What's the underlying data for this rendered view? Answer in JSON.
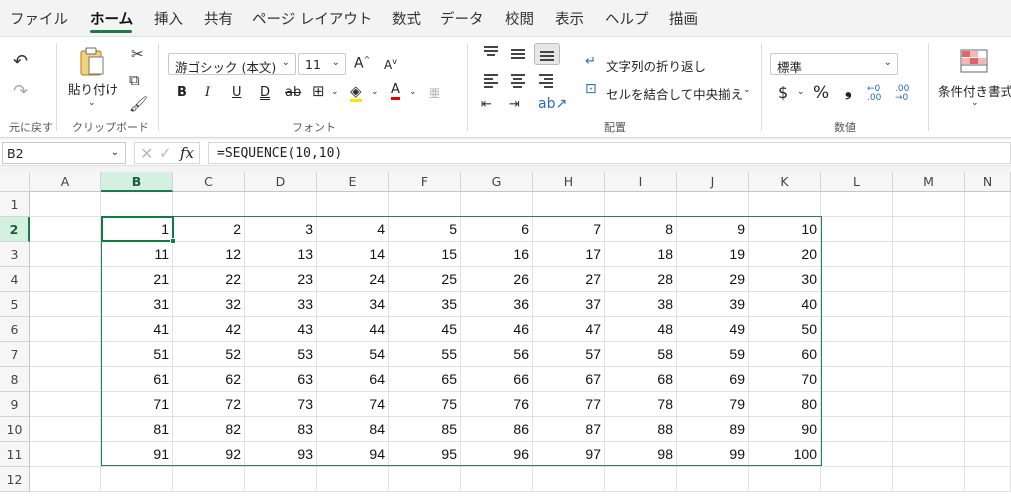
{
  "menu": {
    "tabs": [
      "ファイル",
      "ホーム",
      "挿入",
      "共有",
      "ページ レイアウト",
      "数式",
      "データ",
      "校閲",
      "表示",
      "ヘルプ",
      "描画"
    ],
    "active": "ホーム"
  },
  "ribbon": {
    "undo_label": "元に戻す",
    "clipboard": {
      "paste_label": "貼り付け",
      "group_label": "クリップボード"
    },
    "font": {
      "name": "游ゴシック (本文)",
      "size": "11",
      "group_label": "フォント",
      "bold": "B",
      "italic": "I",
      "underline": "U",
      "double_underline": "D",
      "strike": "ab",
      "font_color_glyph": "A",
      "phonetic_glyph": "亜"
    },
    "alignment": {
      "wrap_text": "文字列の折り返し",
      "merge_center": "セルを結合して中央揃え",
      "group_label": "配置"
    },
    "number": {
      "format": "標準",
      "currency": "$",
      "percent": "%",
      "comma": "❟",
      "inc_decimal": "←.0\n.00",
      "dec_decimal": ".00\n→.0",
      "group_label": "数値"
    },
    "styles": {
      "conditional_label": "条件付き書式"
    }
  },
  "formula_bar": {
    "name_box": "B2",
    "formula": "=SEQUENCE(10,10)"
  },
  "sheet": {
    "columns": [
      "A",
      "B",
      "C",
      "D",
      "E",
      "F",
      "G",
      "H",
      "I",
      "J",
      "K",
      "L",
      "M",
      "N"
    ],
    "selected_column": "B",
    "rows": [
      "1",
      "2",
      "3",
      "4",
      "5",
      "6",
      "7",
      "8",
      "9",
      "10",
      "11",
      "12"
    ],
    "selected_row": "2",
    "values": [
      [
        1,
        2,
        3,
        4,
        5,
        6,
        7,
        8,
        9,
        10
      ],
      [
        11,
        12,
        13,
        14,
        15,
        16,
        17,
        18,
        19,
        20
      ],
      [
        21,
        22,
        23,
        24,
        25,
        26,
        27,
        28,
        29,
        30
      ],
      [
        31,
        32,
        33,
        34,
        35,
        36,
        37,
        38,
        39,
        40
      ],
      [
        41,
        42,
        43,
        44,
        45,
        46,
        47,
        48,
        49,
        50
      ],
      [
        51,
        52,
        53,
        54,
        55,
        56,
        57,
        58,
        59,
        60
      ],
      [
        61,
        62,
        63,
        64,
        65,
        66,
        67,
        68,
        69,
        70
      ],
      [
        71,
        72,
        73,
        74,
        75,
        76,
        77,
        78,
        79,
        80
      ],
      [
        81,
        82,
        83,
        84,
        85,
        86,
        87,
        88,
        89,
        90
      ],
      [
        91,
        92,
        93,
        94,
        95,
        96,
        97,
        98,
        99,
        100
      ]
    ]
  },
  "colors": {
    "accent": "#107c41",
    "range_border": "#2f7b6b",
    "font_color": "#e00000",
    "highlight": "#ffe600"
  }
}
